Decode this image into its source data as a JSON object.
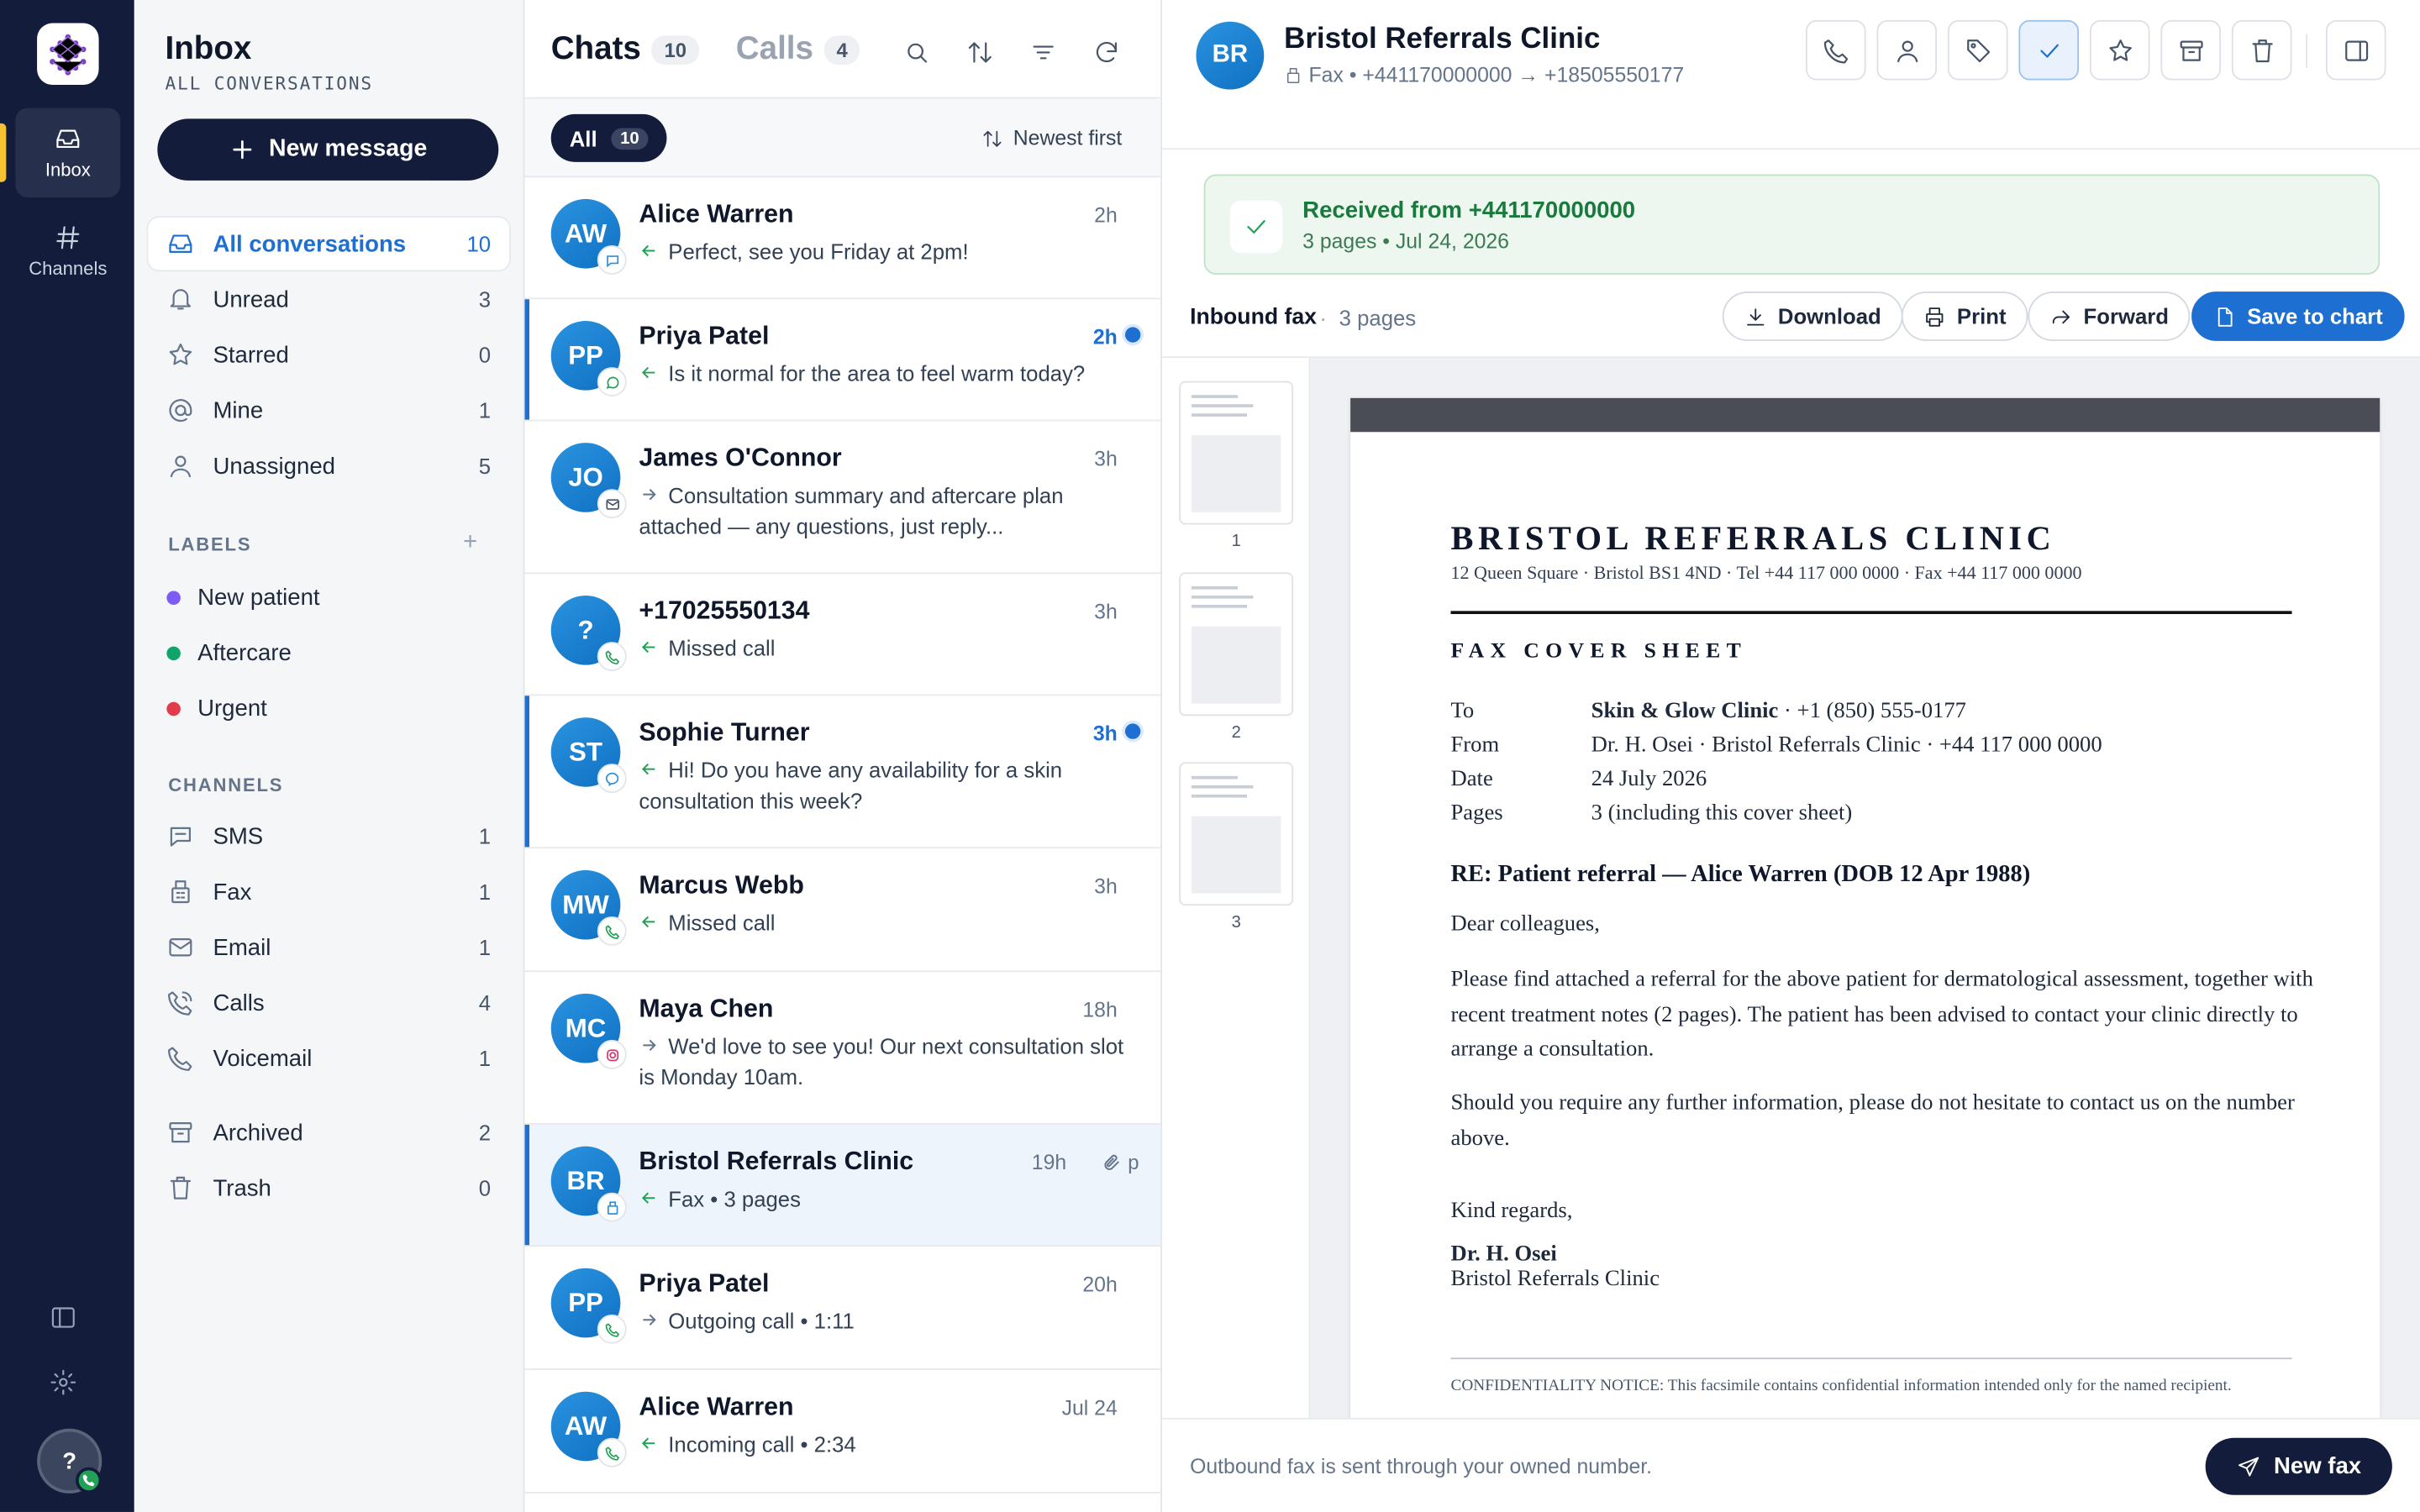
{
  "rail": {
    "inbox_label": "Inbox",
    "channels_label": "Channels",
    "user_initial": "?"
  },
  "sidebar": {
    "title": "Inbox",
    "subtitle": "ALL CONVERSATIONS",
    "new_message": "New message",
    "nav": [
      {
        "label": "All conversations",
        "count": "10",
        "icon": "inbox-icon"
      },
      {
        "label": "Unread",
        "count": "3",
        "icon": "bell-icon"
      },
      {
        "label": "Starred",
        "count": "0",
        "icon": "star-icon"
      },
      {
        "label": "Mine",
        "count": "1",
        "icon": "at-icon"
      },
      {
        "label": "Unassigned",
        "count": "5",
        "icon": "user-icon"
      }
    ],
    "labels_heading": "LABELS",
    "labels": [
      {
        "label": "New patient",
        "color": "#7c5cf5"
      },
      {
        "label": "Aftercare",
        "color": "#10a36a"
      },
      {
        "label": "Urgent",
        "color": "#e23b4b"
      }
    ],
    "channels_heading": "CHANNELS",
    "channels": [
      {
        "label": "SMS",
        "count": "1",
        "icon": "sms-icon"
      },
      {
        "label": "Fax",
        "count": "1",
        "icon": "fax-icon"
      },
      {
        "label": "Email",
        "count": "1",
        "icon": "mail-icon"
      },
      {
        "label": "Calls",
        "count": "4",
        "icon": "phone-icon"
      },
      {
        "label": "Voicemail",
        "count": "1",
        "icon": "voicemail-icon"
      }
    ],
    "other": [
      {
        "label": "Archived",
        "count": "2",
        "icon": "archive-icon"
      },
      {
        "label": "Trash",
        "count": "0",
        "icon": "trash-icon"
      }
    ]
  },
  "list": {
    "tab_chats": "Chats",
    "tab_chats_count": "10",
    "tab_calls": "Calls",
    "tab_calls_count": "4",
    "filter_all": "All",
    "filter_all_count": "10",
    "sort": "Newest first",
    "rows": [
      {
        "initials": "AW",
        "name": "Alice Warren",
        "time": "2h",
        "dir": "in",
        "preview": "Perfect, see you Friday at 2pm!",
        "channel": "sms"
      },
      {
        "initials": "PP",
        "name": "Priya Patel",
        "time": "2h",
        "dir": "in",
        "preview": "Is it normal for the area to feel warm today?",
        "channel": "whatsapp",
        "unread": true
      },
      {
        "initials": "JO",
        "name": "James O'Connor",
        "time": "3h",
        "dir": "out",
        "preview": "Consultation summary and aftercare plan attached — any questions, just reply...",
        "channel": "email"
      },
      {
        "initials": "?",
        "name": "+17025550134",
        "time": "3h",
        "dir": "in",
        "preview": "Missed call",
        "channel": "phone"
      },
      {
        "initials": "ST",
        "name": "Sophie Turner",
        "time": "3h",
        "dir": "in",
        "preview": "Hi! Do you have any availability for a skin consultation this week?",
        "channel": "messenger",
        "unread": true
      },
      {
        "initials": "MW",
        "name": "Marcus Webb",
        "time": "3h",
        "dir": "in",
        "preview": "Missed call",
        "channel": "phone"
      },
      {
        "initials": "MC",
        "name": "Maya Chen",
        "time": "18h",
        "dir": "out",
        "preview": "We'd love to see you! Our next consultation slot is Monday 10am.",
        "channel": "instagram"
      },
      {
        "initials": "BR",
        "name": "Bristol Referrals Clinic",
        "time": "19h",
        "dir": "in",
        "preview": "Fax • 3 pages",
        "channel": "fax",
        "selected": true,
        "extra": "p"
      },
      {
        "initials": "PP",
        "name": "Priya Patel",
        "time": "20h",
        "dir": "out",
        "preview": "Outgoing call • 1:11",
        "channel": "phone"
      },
      {
        "initials": "AW",
        "name": "Alice Warren",
        "time": "Jul 24",
        "dir": "in",
        "preview": "Incoming call • 2:34",
        "channel": "phone"
      }
    ]
  },
  "detail": {
    "initials": "BR",
    "name": "Bristol Referrals Clinic",
    "sub": "Fax • +441170000000 → +18505550177",
    "banner_title": "Received from +441170000000",
    "banner_sub": "3 pages • Jul 24, 2026",
    "fax_label": "Inbound fax",
    "fax_sep": "·",
    "fax_pages": "3 pages",
    "actions": {
      "download": "Download",
      "print": "Print",
      "forward": "Forward",
      "save": "Save to chart"
    },
    "thumbs": [
      "1",
      "2",
      "3"
    ],
    "doc": {
      "clinic": "BRISTOL REFERRALS CLINIC",
      "address": "12 Queen Square · Bristol BS1 4ND · Tel +44 117 000 0000 · Fax +44 117 000 0000",
      "heading": "FAX COVER SHEET",
      "to_k": "To",
      "to_bold": "Skin & Glow Clinic",
      "to_rest": " · +1 (850) 555-0177",
      "from_k": "From",
      "from_v": "Dr. H. Osei · Bristol Referrals Clinic · +44 117 000 0000",
      "date_k": "Date",
      "date_v": "24 July 2026",
      "pages_k": "Pages",
      "pages_v": "3 (including this cover sheet)",
      "re": "RE: Patient referral — Alice Warren (DOB 12 Apr 1988)",
      "greeting": "Dear colleagues,",
      "p1": "Please find attached a referral for the above patient for dermatological assessment, together with recent treatment notes (2 pages). The patient has been advised to contact your clinic directly to arrange a consultation.",
      "p2": "Should you require any further information, please do not hesitate to contact us on the number above.",
      "closing": "Kind regards,",
      "signer": "Dr. H. Osei",
      "signer_org": "Bristol Referrals Clinic",
      "confidential": "CONFIDENTIALITY NOTICE: This facsimile contains confidential information intended only for the named recipient."
    },
    "footer_note": "Outbound fax is sent through your owned number.",
    "new_fax": "New fax"
  }
}
